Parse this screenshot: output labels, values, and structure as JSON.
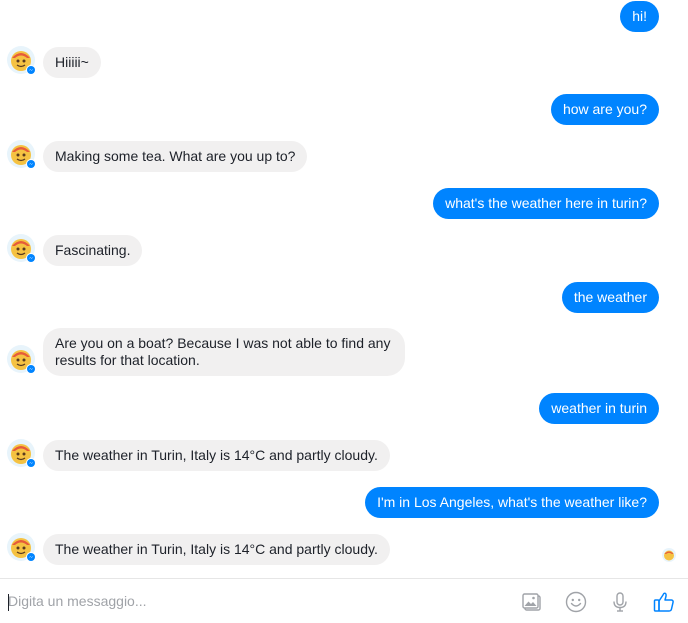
{
  "colors": {
    "outgoing_bubble": "#0084ff",
    "incoming_bubble": "#f1f0f0",
    "like_icon": "#0084ff",
    "composer_icons": "#a0a3a8"
  },
  "messages": [
    {
      "direction": "outgoing",
      "text": "hi!"
    },
    {
      "direction": "incoming",
      "text": "Hiiiii~"
    },
    {
      "direction": "outgoing",
      "text": "how are you?"
    },
    {
      "direction": "incoming",
      "text": "Making some tea. What are you up to?"
    },
    {
      "direction": "outgoing",
      "text": "what's the weather here in turin?"
    },
    {
      "direction": "incoming",
      "text": "Fascinating."
    },
    {
      "direction": "outgoing",
      "text": "the weather"
    },
    {
      "direction": "incoming",
      "text": "Are you on a boat? Because I was not able to find any results for that location."
    },
    {
      "direction": "outgoing",
      "text": "weather in turin"
    },
    {
      "direction": "incoming",
      "text": "The weather in Turin, Italy is 14°C and partly cloudy."
    },
    {
      "direction": "outgoing",
      "text": "I'm in Los Angeles, what's the weather like?"
    },
    {
      "direction": "incoming",
      "text": "The weather in Turin, Italy is 14°C and partly cloudy."
    }
  ],
  "bot_avatar_icon": "weather-bot-avatar-icon",
  "messenger_badge_icon": "messenger-badge-icon",
  "seen_indicator_icon": "seen-avatar-icon",
  "composer": {
    "placeholder": "Digita un messaggio...",
    "value": "",
    "icons": [
      "photo-icon",
      "emoji-icon",
      "microphone-icon",
      "thumbs-up-icon"
    ]
  }
}
